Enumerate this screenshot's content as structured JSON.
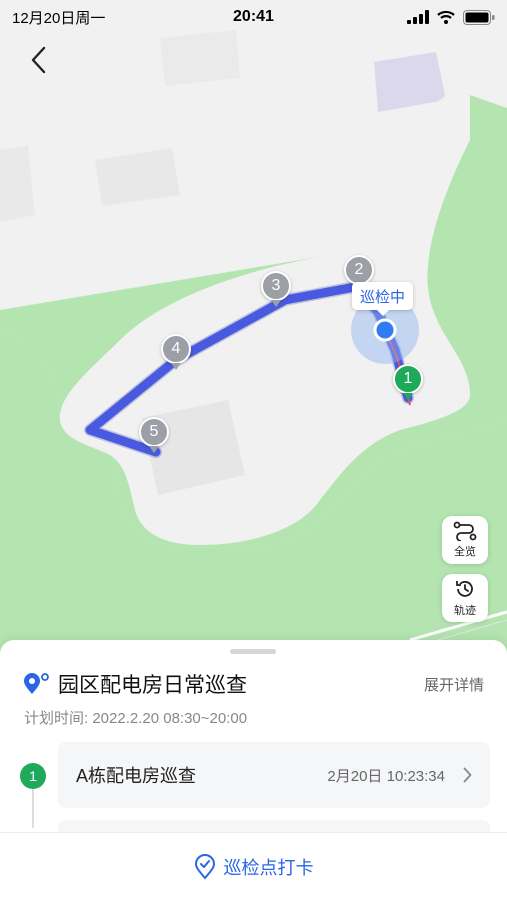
{
  "statusbar": {
    "date": "12月20日周一",
    "time": "20:41"
  },
  "map": {
    "markers": [
      "1",
      "2",
      "3",
      "4",
      "5"
    ],
    "status_tag": "巡检中",
    "controls": {
      "overview": "全览",
      "track": "轨迹"
    },
    "colors": {
      "route": "#4a5ae0",
      "green_area": "#b4e5b0",
      "active_marker": "#1eaa5a",
      "inactive_marker": "#9c9fa6",
      "location": "#2f7cf6"
    }
  },
  "sheet": {
    "task_title": "园区配电房日常巡查",
    "expand": "展开详情",
    "plan_time": "计划时间: 2022.2.20 08:30~20:00",
    "points": [
      {
        "index": "1",
        "name": "A栋配电房巡查",
        "time": "2月20日 10:23:34"
      }
    ]
  },
  "bottom": {
    "checkin": "巡检点打卡"
  },
  "accent": "#2a65e6"
}
